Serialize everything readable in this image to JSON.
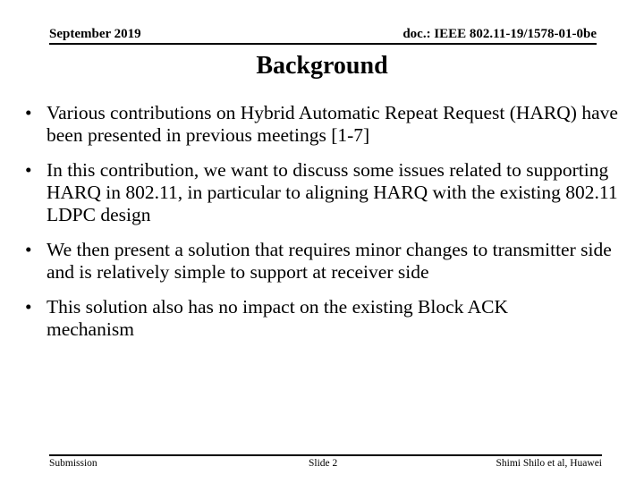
{
  "header": {
    "date": "September 2019",
    "doc_id": "doc.: IEEE 802.11-19/1578-01-0be"
  },
  "title": "Background",
  "bullets": [
    "Various contributions on Hybrid Automatic Repeat Request (HARQ) have been presented in previous meetings [1-7]",
    "In this contribution, we want to discuss some issues related to supporting HARQ in 802.11, in particular to aligning HARQ with the existing 802.11 LDPC design",
    "We then present a solution that requires minor changes to transmitter side and is relatively simple to support at receiver side",
    "This solution also has no impact on the existing Block ACK mechanism"
  ],
  "bullet_glyph": "•",
  "footer": {
    "left": "Submission",
    "center": "Slide 2",
    "right": "Shimi Shilo et al, Huawei"
  }
}
